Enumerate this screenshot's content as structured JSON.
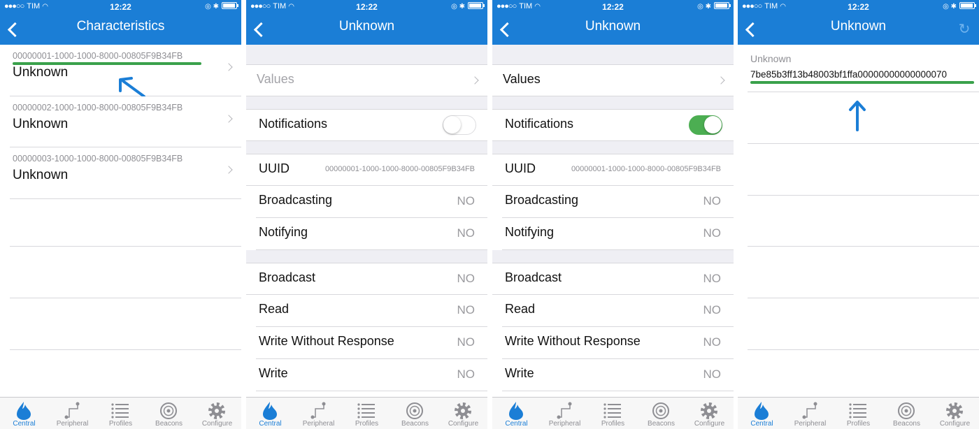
{
  "status": {
    "carrier": "TIM",
    "time": "12:22"
  },
  "colors": {
    "nav": "#1b7ed6",
    "accent_green": "#3aa14b",
    "toggle_on": "#4cae52"
  },
  "screen1": {
    "title": "Characteristics",
    "items": [
      {
        "uuid": "00000001-1000-1000-8000-00805F9B34FB",
        "name": "Unknown"
      },
      {
        "uuid": "00000002-1000-1000-8000-00805F9B34FB",
        "name": "Unknown"
      },
      {
        "uuid": "00000003-1000-1000-8000-00805F9B34FB",
        "name": "Unknown"
      }
    ]
  },
  "screen2": {
    "title": "Unknown",
    "values_label": "Values",
    "notifications_label": "Notifications",
    "notifications_on": false,
    "uuid_label": "UUID",
    "uuid_value": "00000001-1000-1000-8000-00805F9B34FB",
    "broadcasting_label": "Broadcasting",
    "broadcasting_value": "NO",
    "notifying_label": "Notifying",
    "notifying_value": "NO",
    "broadcast_label": "Broadcast",
    "broadcast_value": "NO",
    "read_label": "Read",
    "read_value": "NO",
    "wwr_label": "Write Without Response",
    "wwr_value": "NO",
    "write_label": "Write",
    "write_value": "NO"
  },
  "screen3": {
    "title": "Unknown",
    "values_label": "Values",
    "notifications_label": "Notifications",
    "notifications_on": true,
    "uuid_label": "UUID",
    "uuid_value": "00000001-1000-1000-8000-00805F9B34FB",
    "broadcasting_label": "Broadcasting",
    "broadcasting_value": "NO",
    "notifying_label": "Notifying",
    "notifying_value": "NO",
    "broadcast_label": "Broadcast",
    "broadcast_value": "NO",
    "read_label": "Read",
    "read_value": "NO",
    "wwr_label": "Write Without Response",
    "wwr_value": "NO",
    "write_label": "Write",
    "write_value": "NO"
  },
  "screen4": {
    "title": "Unknown",
    "value_label": "Unknown",
    "value": "7be85b3ff13b48003bf1ffa00000000000000070"
  },
  "tabs": [
    {
      "label": "Central",
      "icon": "flame-icon"
    },
    {
      "label": "Peripheral",
      "icon": "peripheral-icon"
    },
    {
      "label": "Profiles",
      "icon": "list-icon"
    },
    {
      "label": "Beacons",
      "icon": "beacon-icon"
    },
    {
      "label": "Configure",
      "icon": "gear-icon"
    }
  ]
}
